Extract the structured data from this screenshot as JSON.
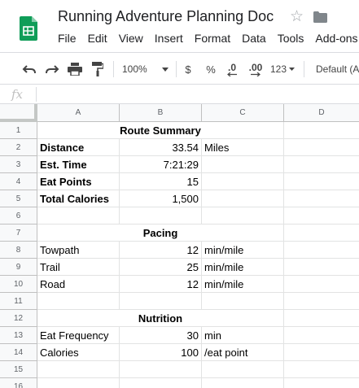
{
  "app": {
    "title": "Running Adventure Planning Doc",
    "brand_color": "#0f9d58"
  },
  "menu": [
    "File",
    "Edit",
    "View",
    "Insert",
    "Format",
    "Data",
    "Tools",
    "Add-ons"
  ],
  "toolbar": {
    "zoom": "100%",
    "currency": "$",
    "percent": "%",
    "decrease_decimal": ".0",
    "increase_decimal": ".00",
    "number_format": "123",
    "font": "Default (A"
  },
  "formula_bar": {
    "fx": "fx",
    "value": ""
  },
  "columns": [
    "A",
    "B",
    "C",
    "D"
  ],
  "rows": [
    {
      "num": "1",
      "merged": "Route Summary"
    },
    {
      "num": "2",
      "a": "Distance",
      "b": "33.54",
      "c": "Miles",
      "bold": true
    },
    {
      "num": "3",
      "a": "Est. Time",
      "b": "7:21:29",
      "c": "",
      "bold": true
    },
    {
      "num": "4",
      "a": "Eat Points",
      "b": "15",
      "c": "",
      "bold": true
    },
    {
      "num": "5",
      "a": "Total Calories",
      "b": "1,500",
      "c": "",
      "bold": true
    },
    {
      "num": "6",
      "a": "",
      "b": "",
      "c": ""
    },
    {
      "num": "7",
      "merged": "Pacing"
    },
    {
      "num": "8",
      "a": "Towpath",
      "b": "12",
      "c": "min/mile"
    },
    {
      "num": "9",
      "a": "Trail",
      "b": "25",
      "c": "min/mile"
    },
    {
      "num": "10",
      "a": "Road",
      "b": "12",
      "c": "min/mile"
    },
    {
      "num": "11",
      "a": "",
      "b": "",
      "c": ""
    },
    {
      "num": "12",
      "merged": "Nutrition"
    },
    {
      "num": "13",
      "a": "Eat Frequency",
      "b": "30",
      "c": "min"
    },
    {
      "num": "14",
      "a": "Calories",
      "b": "100",
      "c": "/eat point"
    },
    {
      "num": "15",
      "a": "",
      "b": "",
      "c": ""
    },
    {
      "num": "16",
      "a": "",
      "b": "",
      "c": ""
    }
  ]
}
